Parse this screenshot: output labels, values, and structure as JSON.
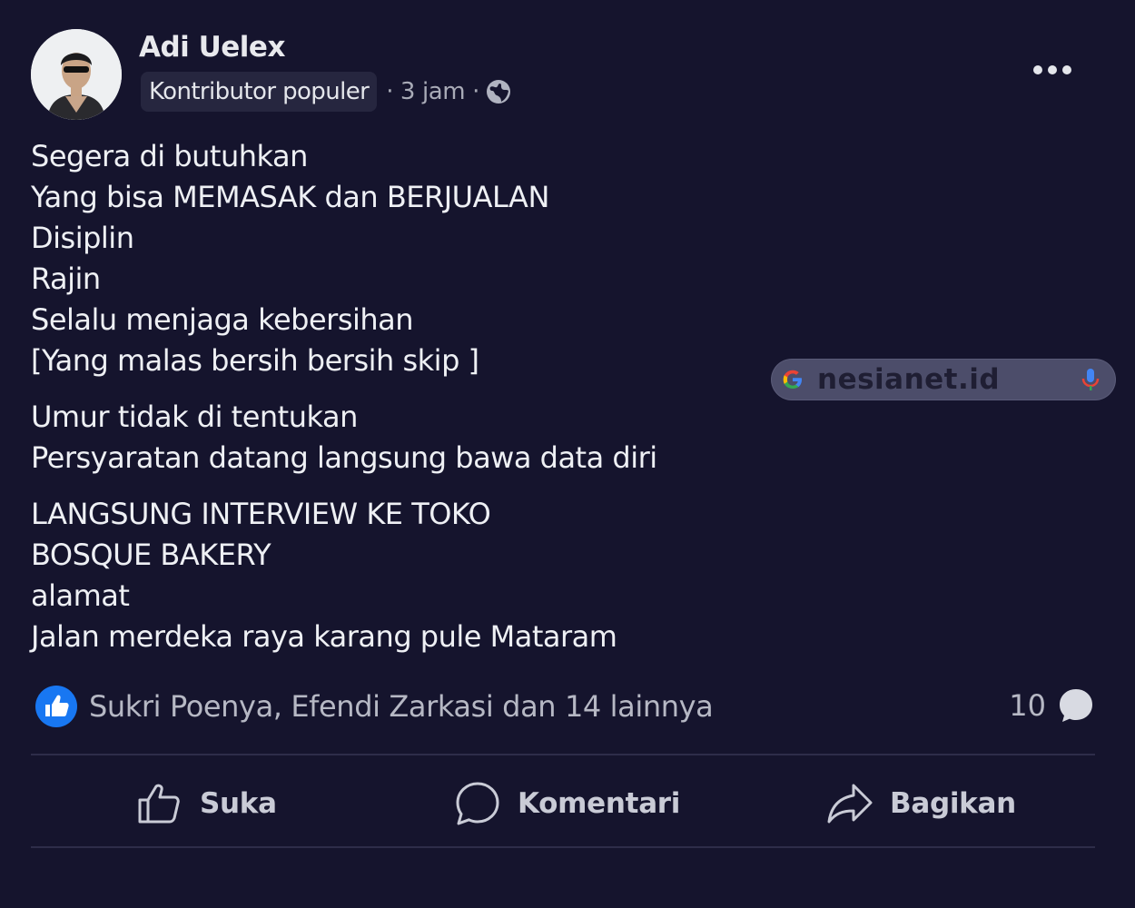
{
  "post": {
    "author": "Adi Uelex",
    "badge": "Kontributor populer",
    "time": "· 3 jam ·",
    "privacy_icon": "globe-icon",
    "more_icon": "more-options-icon",
    "lines_1": [
      "Segera di butuhkan",
      "Yang bisa MEMASAK dan BERJUALAN",
      "Disiplin",
      "Rajin",
      "Selalu menjaga kebersihan",
      "[Yang malas bersih bersih skip ]"
    ],
    "lines_2": [
      "Umur tidak di tentukan",
      "Persyaratan datang langsung bawa data diri"
    ],
    "lines_3": [
      "LANGSUNG INTERVIEW KE TOKO",
      "BOSQUE BAKERY",
      "alamat",
      "Jalan merdeka raya karang pule Mataram"
    ]
  },
  "search_widget": {
    "text": "nesianet.id"
  },
  "reactions": {
    "summary": "Sukri Poenya, Efendi Zarkasi dan 14 lainnya",
    "comment_count": "10"
  },
  "actions": {
    "like": "Suka",
    "comment": "Komentari",
    "share": "Bagikan"
  },
  "colors": {
    "background": "#15142d",
    "like_blue": "#1877f2",
    "text": "#eef0f4",
    "muted": "#b6b8c4"
  }
}
